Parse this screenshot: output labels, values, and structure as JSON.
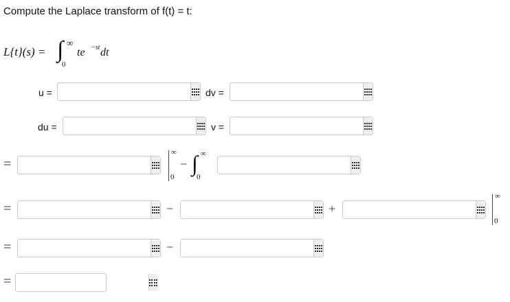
{
  "prompt": {
    "text": "Compute the Laplace transform of f(t) = t:"
  },
  "definition": {
    "lhs": "L{t}(s) =",
    "integral_sign": "∫",
    "lower_limit": "0",
    "upper_limit": "∞",
    "integrand_base": "te",
    "exponent": "−st",
    "differential": "dt"
  },
  "substitution": {
    "u_label": "u =",
    "dv_label": "dv =",
    "du_label": "du =",
    "v_label": "v ="
  },
  "steps": {
    "equals": "=",
    "minus": "−",
    "plus": "+",
    "eval_upper": "∞",
    "eval_lower": "0",
    "int_sign": "∫",
    "int_upper": "∞",
    "int_lower": "0"
  },
  "inputs": {
    "u": "",
    "dv": "",
    "du": "",
    "v": "",
    "row1_a": "",
    "row1_b": "",
    "row2_a": "",
    "row2_b": "",
    "row2_c": "",
    "row3_a": "",
    "row3_b": "",
    "row4_a": ""
  },
  "icons": {
    "keypad": "keypad-grid-icon"
  },
  "colors": {
    "border": "#c9c9c9",
    "button_bg": "#efefef"
  }
}
